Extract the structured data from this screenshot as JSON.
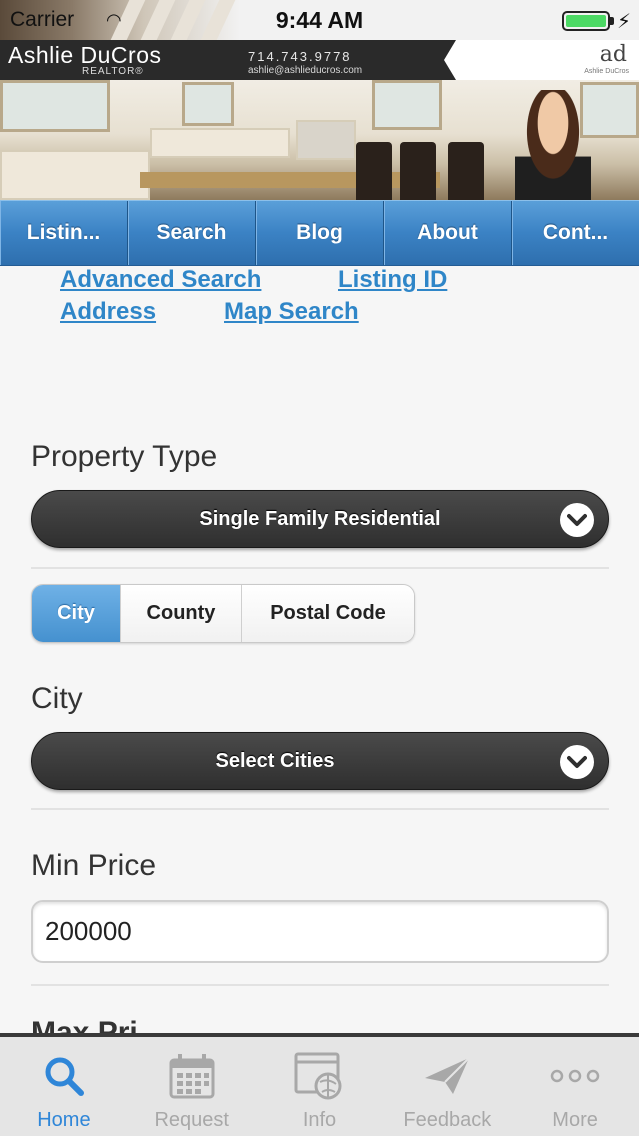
{
  "status_bar": {
    "carrier": "Carrier",
    "time": "9:44 AM"
  },
  "header": {
    "agent_name": "Ashlie DuCros",
    "agent_title": "REALTOR®",
    "phone": "714.743.9778",
    "email": "ashlie@ashlieducros.com",
    "logo_mark": "ad",
    "logo_sub": "Ashlie DuCros"
  },
  "nav": {
    "items": [
      "Listin...",
      "Search",
      "Blog",
      "About",
      "Cont..."
    ]
  },
  "search_links": {
    "advanced": "Advanced Search",
    "listing_id": "Listing ID",
    "address": "Address",
    "map": "Map Search"
  },
  "form": {
    "property_type_label": "Property Type",
    "property_type_value": "Single Family Residential",
    "location_tabs": [
      "City",
      "County",
      "Postal Code"
    ],
    "active_location_tab": "City",
    "city_label": "City",
    "city_value": "Select Cities",
    "min_price_label": "Min Price",
    "min_price_value": "200000",
    "max_price_label_partial": "Max Pri..."
  },
  "tabbar": {
    "items": [
      "Home",
      "Request",
      "Info",
      "Feedback",
      "More"
    ],
    "active": "Home"
  },
  "colors": {
    "accent": "#2f86c8",
    "nav_blue": "#3b82c4",
    "active_tab": "#2f86d8"
  }
}
